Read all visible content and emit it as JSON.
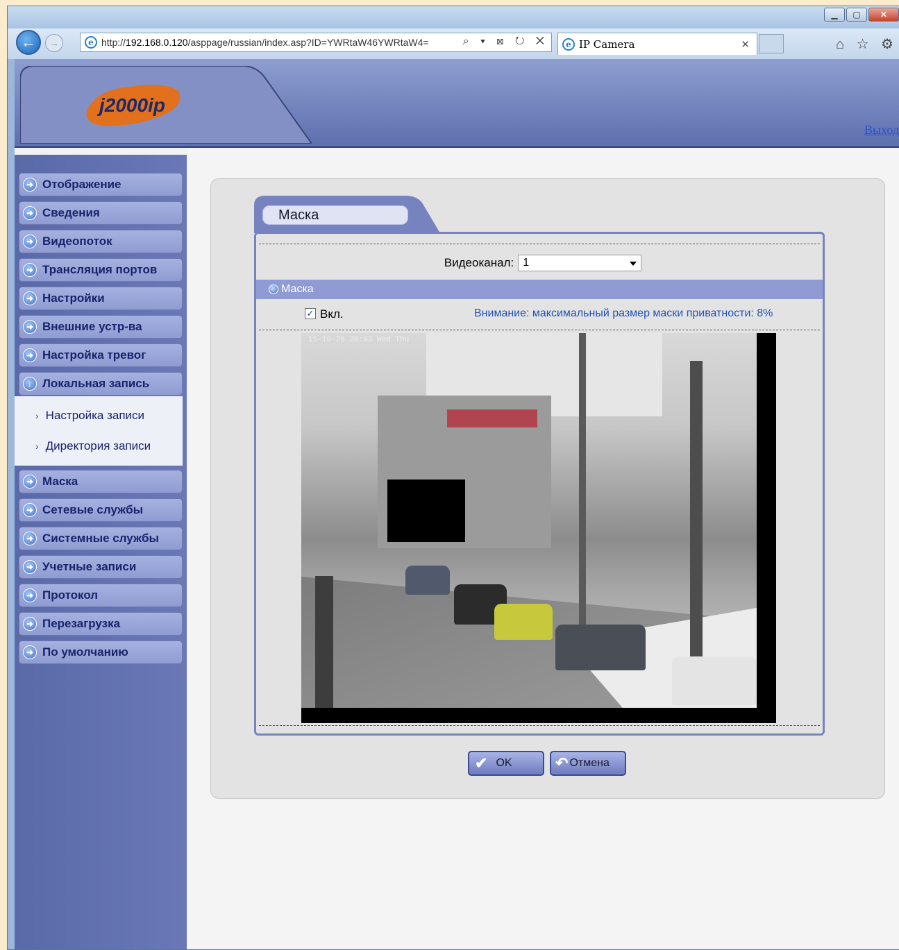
{
  "browser": {
    "url_prefix": "http://",
    "url_domain": "192.168.0.120",
    "url_path": "/asppage/russian/index.asp?ID=YWRtaW46YWRtaW4=",
    "tab_title": "IP Camera",
    "address_tools": "⌕ ▾ ⊠ ↻ ✕",
    "right_icons": "⌂ ☆ ⚙"
  },
  "header": {
    "logo_text": "j2000ip",
    "logout_label": "Выход"
  },
  "sidebar": {
    "items": [
      {
        "label": "Отображение"
      },
      {
        "label": "Сведения"
      },
      {
        "label": "Видеопоток"
      },
      {
        "label": "Трансляция портов"
      },
      {
        "label": "Настройки"
      },
      {
        "label": "Внешние устр-ва"
      },
      {
        "label": "Настройка тревог"
      },
      {
        "label": "Локальная запись"
      }
    ],
    "subitems": [
      {
        "label": "Настройка записи"
      },
      {
        "label": "Директория записи"
      }
    ],
    "items_after": [
      {
        "label": "Маска"
      },
      {
        "label": "Сетевые службы"
      },
      {
        "label": "Системные службы"
      },
      {
        "label": "Учетные записи"
      },
      {
        "label": "Протокол"
      },
      {
        "label": "Перезагрузка"
      },
      {
        "label": "По умолчанию"
      }
    ]
  },
  "form": {
    "tab_title": "Маска",
    "channel_label": "Видеоканал:",
    "channel_value": "1",
    "section_title": "Маска",
    "enable_label": "Вкл.",
    "enable_checked": true,
    "warning": "Внимание: максимальный размер маски приватности: 8%",
    "timestamp": "15-10-28 20:03 Wed Thu",
    "ok_label": "OK",
    "cancel_label": "Отмена"
  },
  "colors": {
    "accent": "#6d7bc0",
    "sidebar": "#5a69a7",
    "warning_text": "#2453b3"
  }
}
